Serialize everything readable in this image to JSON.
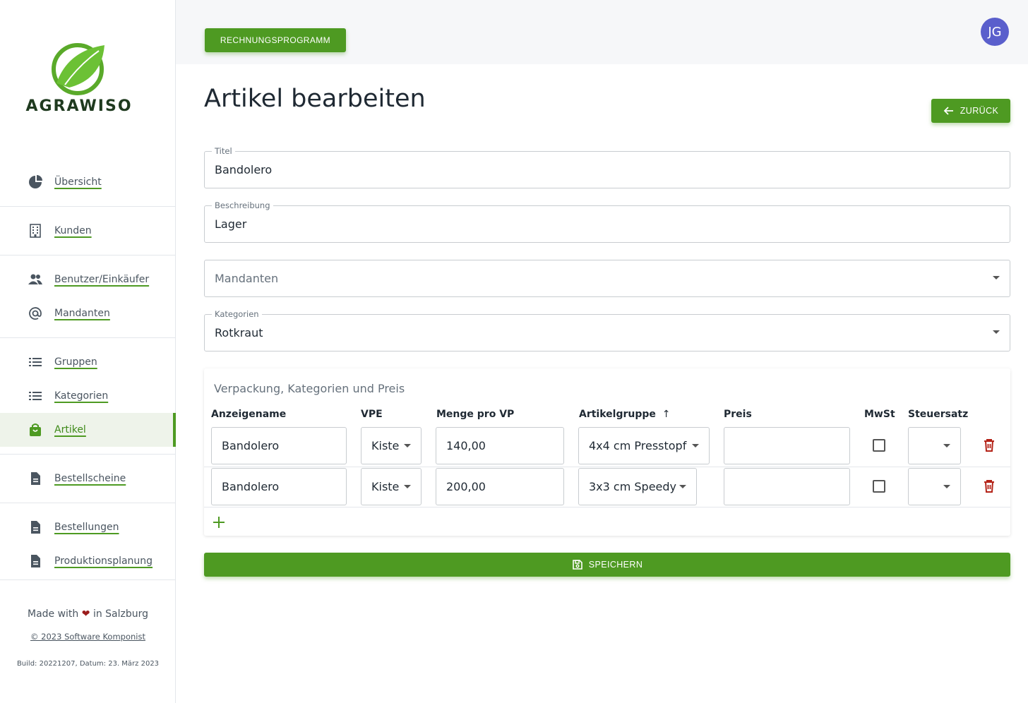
{
  "brand": {
    "name": "AGRAWISO"
  },
  "sidebar": {
    "items": [
      {
        "label": "Übersicht",
        "icon": "pie-chart-icon"
      },
      {
        "label": "Kunden",
        "icon": "building-icon"
      },
      {
        "label": "Benutzer/Einkäufer",
        "icon": "people-icon"
      },
      {
        "label": "Mandanten",
        "icon": "at-sign-icon"
      },
      {
        "label": "Gruppen",
        "icon": "list-icon"
      },
      {
        "label": "Kategorien",
        "icon": "list-icon"
      },
      {
        "label": "Artikel",
        "icon": "bag-icon",
        "active": true
      },
      {
        "label": "Bestellscheine",
        "icon": "document-icon"
      },
      {
        "label": "Bestellungen",
        "icon": "document-icon"
      },
      {
        "label": "Produktionsplanung",
        "icon": "document-icon"
      }
    ],
    "footer": {
      "made_prefix": "Made with",
      "made_suffix": "in Salzburg",
      "copyright": "© 2023 Software Komponist",
      "build": "Build: 20221207, Datum: 23. März 2023"
    }
  },
  "topbar": {
    "app_button": "RECHNUNGSPROGRAMM",
    "avatar": "JG"
  },
  "page": {
    "title": "Artikel bearbeiten",
    "back_label": "ZURÜCK"
  },
  "form": {
    "titel": {
      "label": "Titel",
      "value": "Bandolero"
    },
    "beschreibung": {
      "label": "Beschreibung",
      "value": "Lager"
    },
    "mandanten": {
      "placeholder": "Mandanten"
    },
    "kategorien": {
      "label": "Kategorien",
      "value": "Rotkraut"
    }
  },
  "table": {
    "title": "Verpackung, Kategorien und Preis",
    "columns": [
      "Anzeigename",
      "VPE",
      "Menge pro VP",
      "Artikelgruppe",
      "Preis",
      "MwSt",
      "Steuersatz"
    ],
    "sort_indicator": "↑",
    "rows": [
      {
        "anzeigename": "Bandolero",
        "vpe": "Kiste",
        "menge": "140,00",
        "artikelgruppe": "4x4 cm Presstopf",
        "preis": "",
        "mwst": false,
        "steuersatz": ""
      },
      {
        "anzeigename": "Bandolero",
        "vpe": "Kiste",
        "menge": "200,00",
        "artikelgruppe": "3x3 cm Speedy",
        "preis": "",
        "mwst": false,
        "steuersatz": ""
      }
    ]
  },
  "actions": {
    "save_label": "SPEICHERN"
  },
  "colors": {
    "primary": "#4e9a22",
    "avatar": "#5a5fcc",
    "danger": "#b42318",
    "heart": "#9b1c1c"
  }
}
